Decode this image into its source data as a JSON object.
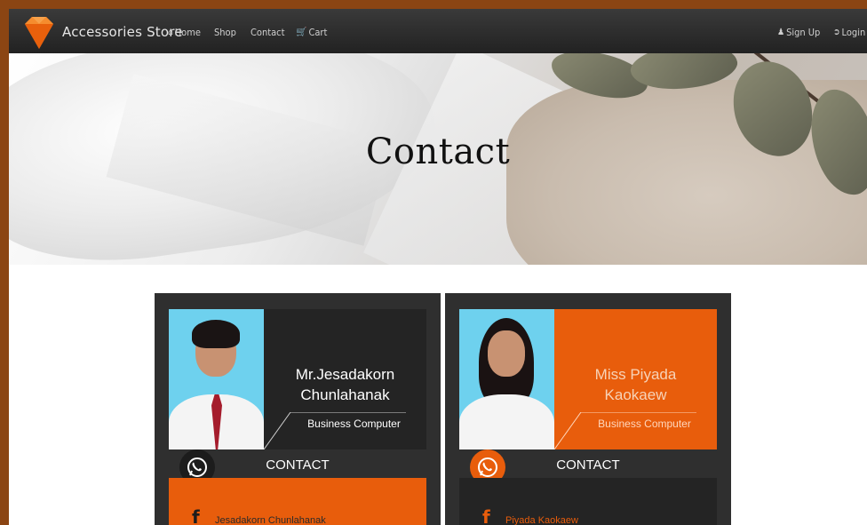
{
  "navbar": {
    "brand": "Accessories Store",
    "links": [
      {
        "label": "Home",
        "icon": "home-icon"
      },
      {
        "label": "Shop"
      },
      {
        "label": "Contact"
      },
      {
        "label": "Cart",
        "icon": "cart-icon"
      }
    ],
    "right_links": [
      {
        "label": "Sign Up",
        "icon": "user-icon"
      },
      {
        "label": "Login",
        "icon": "login-icon"
      }
    ]
  },
  "hero": {
    "title": "Contact"
  },
  "cards": [
    {
      "name_line1": "Mr.Jesadakorn",
      "name_line2": "Chunlahanak",
      "role": "Business Computer",
      "contact_title": "CONTACT",
      "facebook_name": "Jesadakorn  Chunlahanak"
    },
    {
      "name_line1": "Miss Piyada",
      "name_line2": "Kaokaew",
      "role": "Business Computer",
      "contact_title": "CONTACT",
      "facebook_name": "Piyada  Kaokaew"
    }
  ],
  "colors": {
    "accent": "#e85d0c",
    "navbar": "#2b2b2b",
    "card_bg": "#2f2f2f",
    "frame": "#8b4513"
  }
}
